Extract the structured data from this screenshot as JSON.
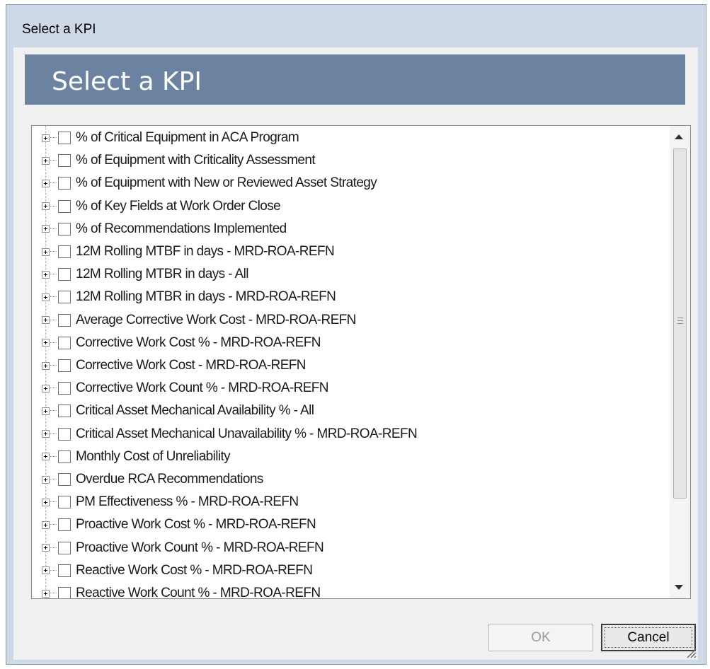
{
  "window": {
    "title": "Select a KPI"
  },
  "header": {
    "title": "Select a KPI"
  },
  "kpi_list": {
    "items": [
      "% of Critical Equipment in ACA Program",
      "% of Equipment with Criticality Assessment",
      "% of Equipment with New or Reviewed Asset Strategy",
      "% of Key Fields at Work Order Close",
      "% of Recommendations Implemented",
      "12M Rolling MTBF in days - MRD-ROA-REFN",
      "12M Rolling MTBR in days - All",
      "12M Rolling MTBR in days - MRD-ROA-REFN",
      "Average Corrective Work Cost - MRD-ROA-REFN",
      "Corrective Work Cost % - MRD-ROA-REFN",
      "Corrective Work Cost - MRD-ROA-REFN",
      "Corrective Work Count % - MRD-ROA-REFN",
      "Critical Asset Mechanical Availability % - All",
      "Critical Asset Mechanical Unavailability % - MRD-ROA-REFN",
      "Monthly Cost of Unreliability",
      "Overdue RCA Recommendations",
      "PM Effectiveness % - MRD-ROA-REFN",
      "Proactive Work Cost % - MRD-ROA-REFN",
      "Proactive Work Count % - MRD-ROA-REFN",
      "Reactive Work Cost % - MRD-ROA-REFN",
      "Reactive Work Count % - MRD-ROA-REFN"
    ]
  },
  "buttons": {
    "ok_label": "OK",
    "cancel_label": "Cancel",
    "ok_enabled": false
  },
  "colors": {
    "header_bg": "#6b83a0",
    "window_frame": "#cdd9e6",
    "client_bg": "#f0f0f0"
  },
  "icons": {
    "expander": "plus-box-icon",
    "scroll_up": "triangle-up-icon",
    "scroll_down": "triangle-down-icon",
    "resize": "resize-grip-icon"
  }
}
